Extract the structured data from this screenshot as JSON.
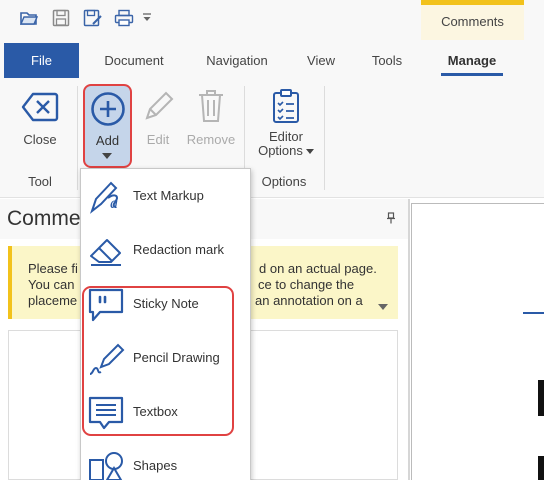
{
  "quick_access": {
    "icons": [
      "open-folder-icon",
      "save-icon",
      "save-as-icon",
      "print-icon",
      "customize-dropdown-icon"
    ]
  },
  "context_tab": {
    "label": "Comments",
    "accent": "#f2c21b"
  },
  "tabs": [
    {
      "label": "File",
      "type": "file"
    },
    {
      "label": "Document"
    },
    {
      "label": "Navigation"
    },
    {
      "label": "View"
    },
    {
      "label": "Tools"
    },
    {
      "label": "Manage",
      "active": true
    }
  ],
  "ribbon": {
    "tool_group": {
      "label": "Tool",
      "close_label": "Close"
    },
    "edit_group": {
      "add_label": "Add",
      "edit_label": "Edit",
      "remove_label": "Remove"
    },
    "options_group": {
      "label": "Options",
      "editor_options_line1": "Editor",
      "editor_options_line2": "Options"
    }
  },
  "comments_panel": {
    "title": "Comme",
    "notice_lines": [
      [
        "Please fi",
        "d on an actual page."
      ],
      [
        "You can",
        "ce to change the"
      ],
      [
        "placeme",
        "an annotation on a"
      ]
    ]
  },
  "add_menu": {
    "items": [
      {
        "label": "Text Markup",
        "icon": "text-markup-icon"
      },
      {
        "label": "Redaction mark",
        "icon": "eraser-icon"
      },
      {
        "label": "Sticky Note",
        "icon": "sticky-note-icon"
      },
      {
        "label": "Pencil Drawing",
        "icon": "pencil-drawing-icon"
      },
      {
        "label": "Textbox",
        "icon": "textbox-icon"
      },
      {
        "label": "Shapes",
        "icon": "shapes-icon"
      }
    ]
  },
  "colors": {
    "brand_blue": "#2a5aa7",
    "highlight_red": "#e04242",
    "notice_yellow": "#fbf6c8",
    "add_button_bg": "#c5d5ea"
  }
}
